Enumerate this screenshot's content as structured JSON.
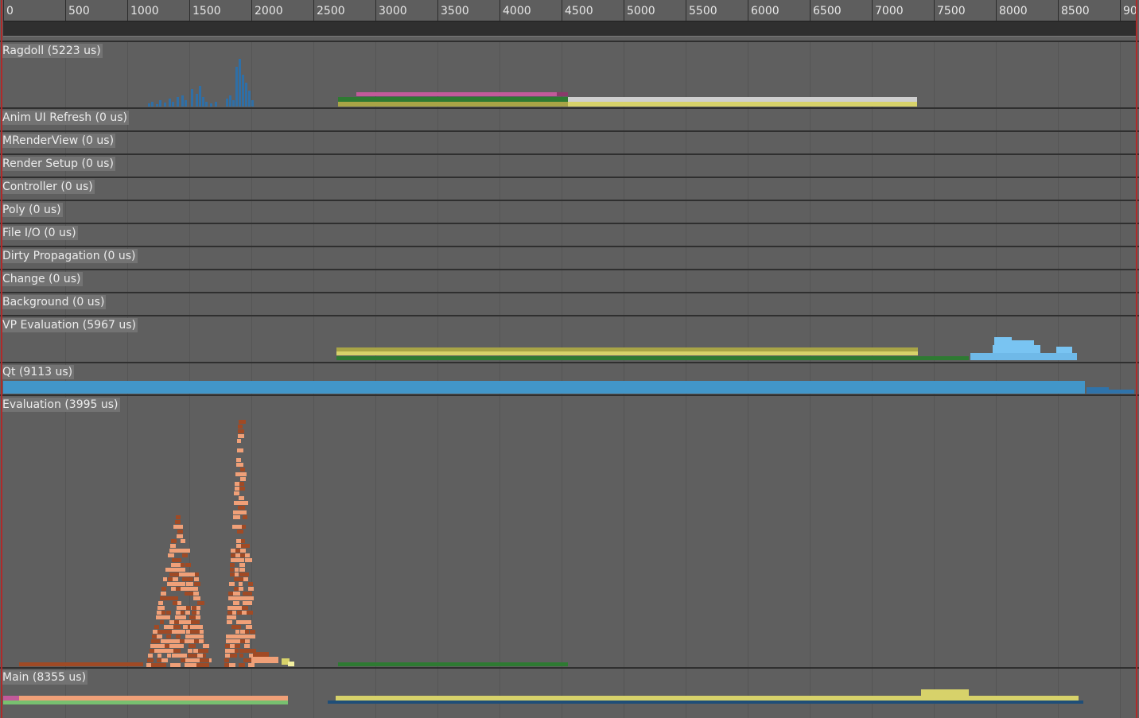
{
  "timeline": {
    "ruler_ticks": [
      "0",
      "500",
      "1000",
      "1500",
      "2000",
      "2500",
      "3000",
      "3500",
      "4000",
      "4500",
      "5000",
      "5500",
      "6000",
      "6500",
      "7000",
      "7500",
      "8000",
      "8500",
      "90"
    ],
    "tracks": [
      {
        "label": "Ragdoll (5223 us)"
      },
      {
        "label": "Anim UI Refresh (0 us)"
      },
      {
        "label": "MRenderView (0 us)"
      },
      {
        "label": "Render Setup (0 us)"
      },
      {
        "label": "Controller (0 us)"
      },
      {
        "label": "Poly (0 us)"
      },
      {
        "label": "File I/O (0 us)"
      },
      {
        "label": "Dirty Propagation (0 us)"
      },
      {
        "label": "Change (0 us)"
      },
      {
        "label": "Background (0 us)"
      },
      {
        "label": "VP Evaluation (5967 us)"
      },
      {
        "label": "Qt (9113 us)"
      },
      {
        "label": "Evaluation (3995 us)"
      },
      {
        "label": "Main (8355 us)"
      }
    ]
  },
  "colors": {
    "background": "#5f5f5f",
    "ruler_background": "#5e5e5e",
    "scrub_bar": "#2f2f2f",
    "label_background": "#737373",
    "ragdoll_blue": "#2f6fa6",
    "qt_blue": "#4296c9",
    "vp_light_blue": "#79c4f2",
    "evaluation_orange": "#f0a078",
    "evaluation_brown": "#a04a25",
    "olive": "#a8a446",
    "yellow": "#d7d26a",
    "green": "#2e7a32",
    "pink": "#c25a9a",
    "light_gray": "#cfcfcf",
    "red_edge": "#b02a2a"
  }
}
